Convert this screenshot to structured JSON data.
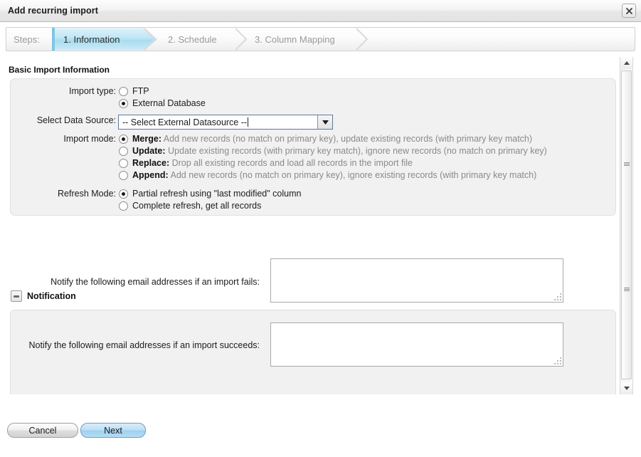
{
  "window": {
    "title": "Add recurring import",
    "close_icon": "close-icon"
  },
  "steps": {
    "label": "Steps:",
    "items": [
      {
        "label": "1. Information",
        "active": true
      },
      {
        "label": "2. Schedule",
        "active": false
      },
      {
        "label": "3. Column Mapping",
        "active": false
      }
    ]
  },
  "basic": {
    "heading": "Basic Import Information",
    "import_type": {
      "label": "Import type:",
      "options": [
        {
          "label": "FTP",
          "selected": false
        },
        {
          "label": "External Database",
          "selected": true
        }
      ]
    },
    "data_source": {
      "label": "Select Data Source:",
      "value": "-- Select External Datasource --",
      "caret_icon": "chevron-down-icon"
    },
    "import_mode": {
      "label": "Import mode:",
      "options": [
        {
          "name": "Merge:",
          "desc": "Add new records (no match on primary key), update existing records (with primary key match)",
          "selected": true
        },
        {
          "name": "Update:",
          "desc": "Update existing records (with primary key match), ignore new records (no match on primary key)",
          "selected": false
        },
        {
          "name": "Replace:",
          "desc": "Drop all existing records and load all records in the import file",
          "selected": false
        },
        {
          "name": "Append:",
          "desc": "Add new records (no match on primary key), ignore existing records (with primary key match)",
          "selected": false
        }
      ]
    },
    "refresh_mode": {
      "label": "Refresh Mode:",
      "options": [
        {
          "label": "Partial refresh using \"last modified\" column",
          "selected": true
        },
        {
          "label": "Complete refresh, get all records",
          "selected": false
        }
      ]
    }
  },
  "notification": {
    "heading": "Notification",
    "collapse_icon": "minus-box-icon",
    "fail_label": "Notify the following email addresses if an import fails:",
    "fail_value": "",
    "success_label": "Notify the following email addresses if an import succeeds:",
    "success_value": ""
  },
  "scrollbar": {
    "up_icon": "triangle-up-icon",
    "down_icon": "triangle-down-icon"
  },
  "footer": {
    "cancel_label": "Cancel",
    "next_label": "Next"
  },
  "colors": {
    "accent": "#a8dcf0",
    "panel": "#f1f1f1",
    "muted_text": "#8a8a8a",
    "primary_button": "#9ed0f0"
  }
}
